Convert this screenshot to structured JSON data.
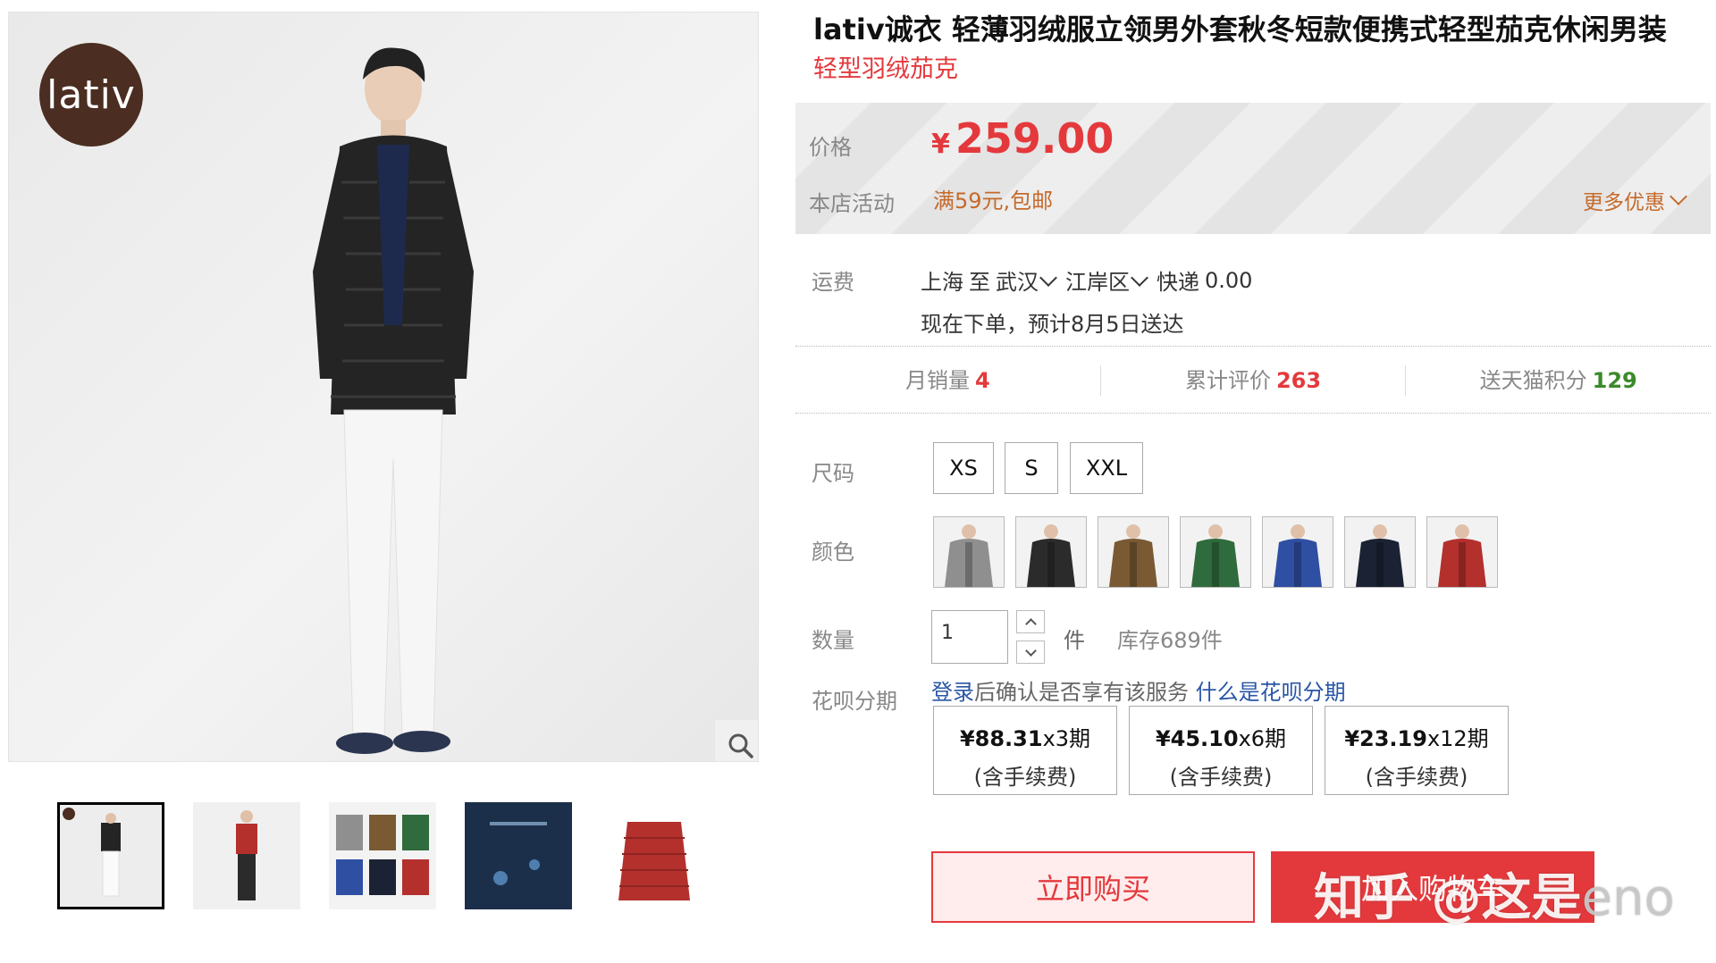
{
  "product": {
    "title": "lativ诚衣 轻薄羽绒服立领男外套秋冬短款便携式轻型茄克休闲男装",
    "subtitle": "轻型羽绒茄克",
    "brand_logo_text": "lativ"
  },
  "price": {
    "label": "价格",
    "currency": "¥",
    "value": "259.00",
    "promo_label": "本店活动",
    "promo_text": "满59元,包邮",
    "more_offers": "更多优惠"
  },
  "shipping": {
    "label": "运费",
    "from": "上海",
    "to_word": "至",
    "city": "武汉",
    "district": "江岸区",
    "method": "快递",
    "cost": "0.00",
    "delivery_note": "现在下单，预计8月5日送达"
  },
  "stats": {
    "monthly_sales_label": "月销量",
    "monthly_sales": "4",
    "reviews_label": "累计评价",
    "reviews": "263",
    "points_label": "送天猫积分",
    "points": "129"
  },
  "options": {
    "size_label": "尺码",
    "sizes": [
      "XS",
      "S",
      "XXL"
    ],
    "color_label": "颜色",
    "colors": [
      "#8f8f8f",
      "#2b2b2b",
      "#7a5a33",
      "#2f6b3c",
      "#2f4fa3",
      "#1b2233",
      "#b3302d"
    ]
  },
  "quantity": {
    "label": "数量",
    "value": "1",
    "unit": "件",
    "stock": "库存689件"
  },
  "huabei": {
    "label": "花呗分期",
    "login": "登录",
    "note": "后确认是否享有该服务",
    "what_link": "什么是花呗分期",
    "plans": [
      {
        "amount": "¥88.31",
        "periods": "x3期",
        "fee": "(含手续费)"
      },
      {
        "amount": "¥45.10",
        "periods": "x6期",
        "fee": "(含手续费)"
      },
      {
        "amount": "¥23.19",
        "periods": "x12期",
        "fee": "(含手续费)"
      }
    ]
  },
  "actions": {
    "buy_now": "立即购买",
    "add_cart": "加入购物车"
  },
  "watermark": {
    "text": "知乎 @这是",
    "tail": "eno"
  },
  "colors": {
    "accent": "#e4393c",
    "promo": "#c56a2b",
    "link": "#2a56a6"
  }
}
